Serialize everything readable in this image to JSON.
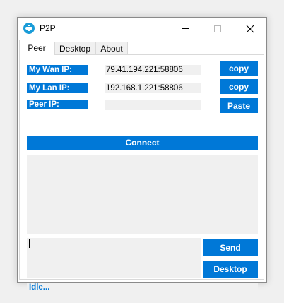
{
  "window": {
    "title": "P2P",
    "icon": "p2p-app-icon",
    "controls": [
      "minimize-icon",
      "maximize-icon",
      "close-icon"
    ]
  },
  "tabs": [
    {
      "label": "Peer",
      "active": true
    },
    {
      "label": "Desktop",
      "active": false
    },
    {
      "label": "About",
      "active": false
    }
  ],
  "peer": {
    "wan": {
      "label": "My Wan IP:",
      "value": "79.41.194.221:58806",
      "button": "copy"
    },
    "lan": {
      "label": "My Lan IP:",
      "value": "192.168.1.221:58806",
      "button": "copy"
    },
    "peer": {
      "label": "Peer IP:",
      "value": "",
      "button": "Paste"
    },
    "connect_label": "Connect",
    "log_text": "",
    "message_text": "",
    "send_label": "Send",
    "desktop_label": "Desktop",
    "status": "Idle..."
  },
  "colors": {
    "accent": "#0078d7",
    "field_bg": "#f0f0f0"
  }
}
